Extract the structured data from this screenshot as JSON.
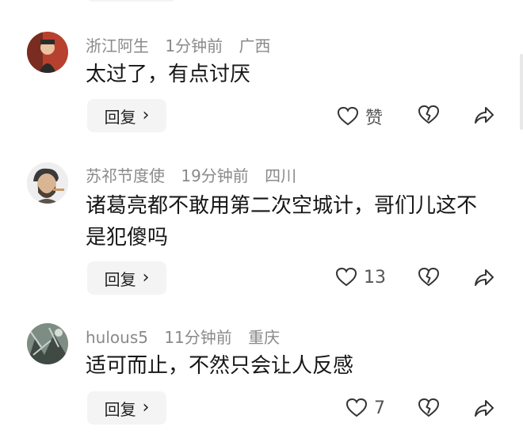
{
  "comments": [
    {
      "username": "浙江阿生",
      "time": "1分钟前",
      "location": "广西",
      "text": "太过了，有点讨厌",
      "reply_label": "回复",
      "like_label": "赞",
      "avatar_icon": "person-photo-avatar"
    },
    {
      "username": "苏祁节度使",
      "time": "19分钟前",
      "location": "四川",
      "text": "诸葛亮都不敢用第二次空城计，哥们儿这不是犯傻吗",
      "reply_label": "回复",
      "like_label": "13",
      "avatar_icon": "smoking-man-avatar"
    },
    {
      "username": "hulous5",
      "time": "11分钟前",
      "location": "重庆",
      "text": "适可而止，不然只会让人反感",
      "reply_label": "回复",
      "like_label": "7",
      "avatar_icon": "scenery-photo-avatar"
    }
  ],
  "icons": {
    "reply_chevron": "chevron-right-icon",
    "like": "heart-icon",
    "dislike": "broken-heart-icon",
    "share": "share-arrow-icon"
  },
  "colors": {
    "meta_text": "#8a8a8a",
    "reply_bg": "#f4f4f4",
    "icon_stroke": "#333333"
  }
}
